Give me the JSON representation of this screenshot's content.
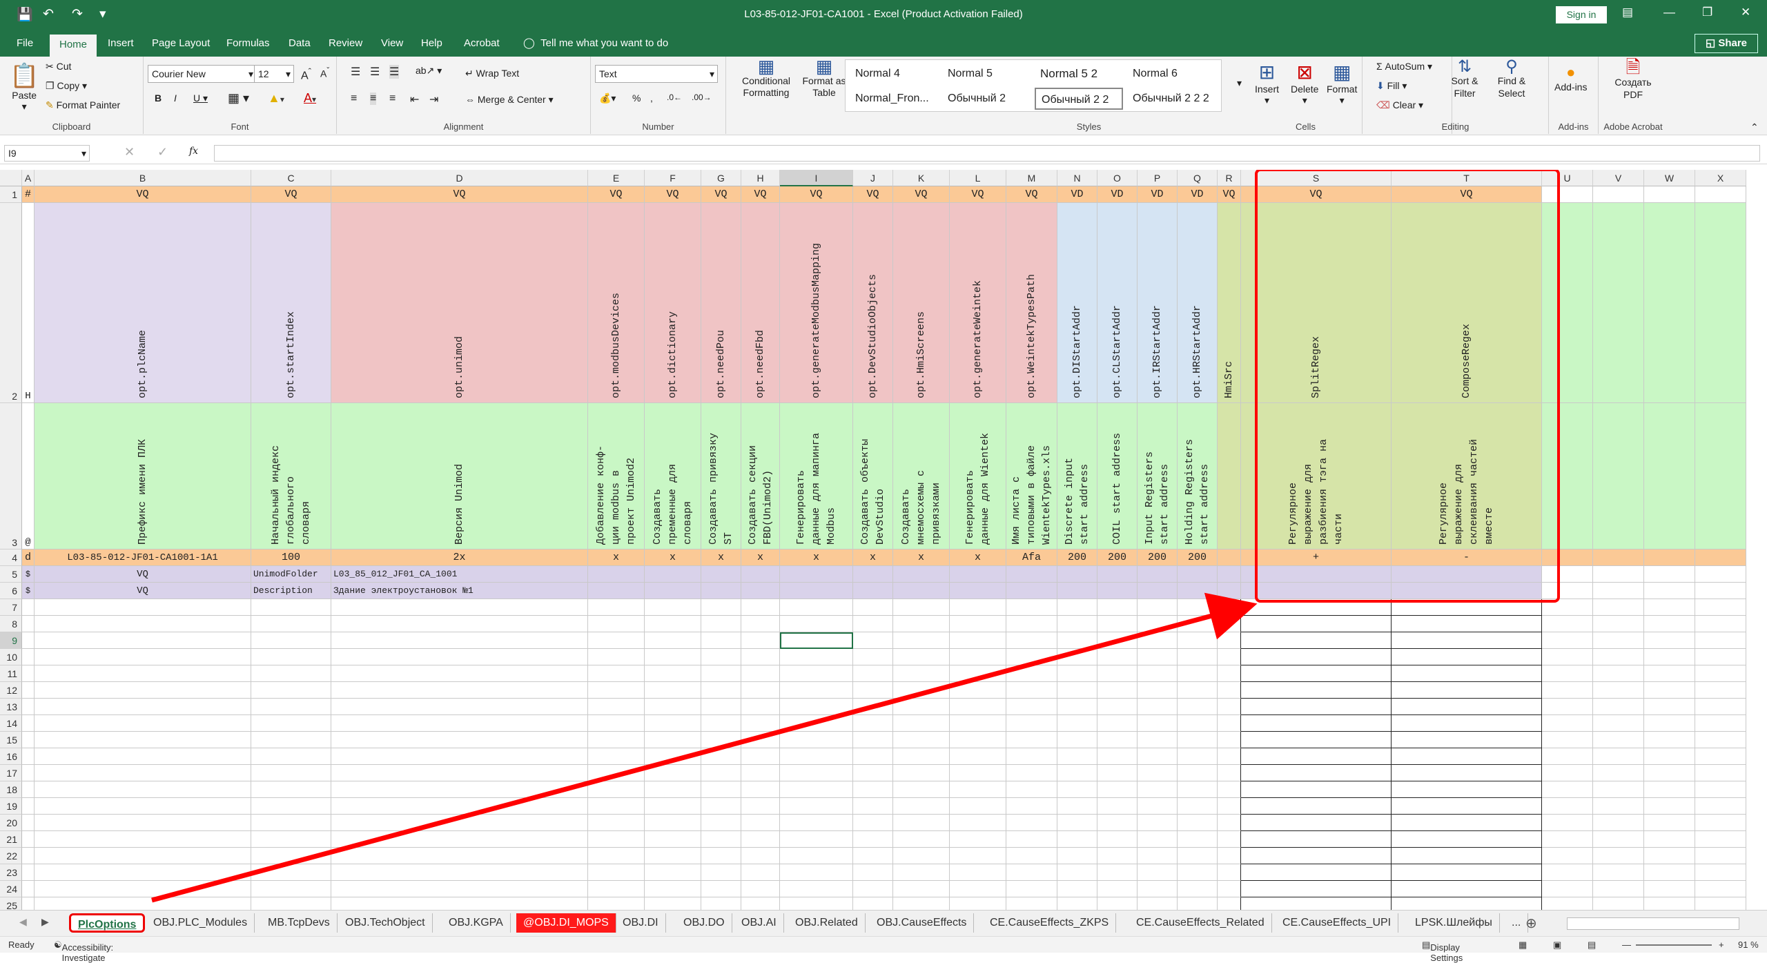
{
  "titlebar": {
    "title": "L03-85-012-JF01-CA1001  -  Excel (Product Activation Failed)",
    "signin": "Sign in"
  },
  "tabs": [
    "File",
    "Home",
    "Insert",
    "Page Layout",
    "Formulas",
    "Data",
    "Review",
    "View",
    "Help",
    "Acrobat"
  ],
  "tellme": "Tell me what you want to do",
  "share": "Share",
  "ribbon": {
    "clipboard": {
      "paste": "Paste",
      "cut": "Cut",
      "copy": "Copy",
      "painter": "Format Painter",
      "label": "Clipboard"
    },
    "font": {
      "name": "Courier New",
      "size": "12",
      "label": "Font"
    },
    "alignment": {
      "wrap": "Wrap Text",
      "merge": "Merge & Center",
      "label": "Alignment"
    },
    "number": {
      "format": "Text",
      "label": "Number"
    },
    "styles": {
      "cond": "Conditional Formatting",
      "fmt_table": "Format as Table",
      "cells": [
        "Normal 4",
        "Normal 5",
        "Normal 5 2",
        "Normal 6",
        "Normal_Fron...",
        "Обычный 2",
        "Обычный 2 2",
        "Обычный 2 2 2"
      ],
      "label": "Styles"
    },
    "cells": {
      "insert": "Insert",
      "delete": "Delete",
      "format": "Format",
      "label": "Cells"
    },
    "editing": {
      "autosum": "AutoSum",
      "fill": "Fill",
      "clear": "Clear",
      "sort": "Sort & Filter",
      "find": "Find & Select",
      "label": "Editing"
    },
    "addins": {
      "btn": "Add-ins",
      "label": "Add-ins"
    },
    "acrobat": {
      "btn": "Создать PDF",
      "label": "Adobe Acrobat"
    }
  },
  "formula": {
    "namebox": "I9",
    "fx": "fx",
    "value": ""
  },
  "grid": {
    "columns": [
      "A",
      "B",
      "C",
      "D",
      "E",
      "F",
      "G",
      "H",
      "I",
      "J",
      "K",
      "L",
      "M",
      "N",
      "O",
      "P",
      "Q",
      "R",
      "S",
      "T",
      "U",
      "V",
      "W",
      "X"
    ],
    "rows": [
      "1",
      "2",
      "3",
      "4",
      "5",
      "6",
      "7",
      "8",
      "9",
      "10",
      "11",
      "12",
      "13",
      "14",
      "15",
      "16",
      "17",
      "18",
      "19",
      "20",
      "21",
      "22",
      "23",
      "24",
      "25"
    ],
    "row1": [
      "#",
      "VQ",
      "VQ",
      "VQ",
      "VQ",
      "VQ",
      "VQ",
      "VQ",
      "VQ",
      "VQ",
      "VQ",
      "VQ",
      "VQ",
      "VD",
      "VD",
      "VD",
      "VD",
      "VQ",
      "VQ",
      "VQ"
    ],
    "row2": [
      "H",
      "opt.plcName",
      "opt.startIndex",
      "opt.unimod",
      "opt.modbusDevices",
      "opt.dictionary",
      "opt.needPou",
      "opt.needFbd",
      "opt.generateModbusMapping",
      "opt.DevStudioObjects",
      "opt.HmiScreens",
      "opt.generateWeintek",
      "opt.WeintekTypesPath",
      "opt.DIStartAddr",
      "opt.CLStartAddr",
      "opt.IRStartAddr",
      "opt.HRStartAddr",
      "HmiSrc",
      "SplitRegex",
      "ComposeRegex"
    ],
    "row3": [
      "@",
      "Префикс имени ПЛК",
      "Начальный индекс\nглобального\nсловаря",
      "Версия Unimod",
      "Добавление конф-\nции modbus в\nпроект Unimod2",
      "Создавать\nпременные для\nсловаря",
      "Создавать привязку\nST",
      "Создавать секции\nFBD(Unimod2)",
      "Генерировать\nданные для мапинга\nModbus",
      "Создавать объекты\nDevStudio",
      "Создавать\nмнемосхемы с\nпривязками",
      "Генерировать\nданные для Wientek",
      "Имя листа с\nтиповыми в файле\nWientekTypes.xls",
      "Discrete input\nstart address",
      "COIL start address",
      "Input Registers\nstart address",
      "Holding Registers\nstart address",
      "",
      "Регулярное\nвыражение для\nразбиения тэга на\nчасти",
      "Регулярное\nвыражение для\nсклеивания частей\nвместе"
    ],
    "row4": [
      "d",
      "L03-85-012-JF01-CA1001-1A1",
      "100",
      "2x",
      "x",
      "x",
      "x",
      "x",
      "x",
      "x",
      "x",
      "x",
      "Afa",
      "200",
      "200",
      "200",
      "200",
      "",
      "+",
      "-"
    ],
    "row5": {
      "a": "$",
      "b": "VQ",
      "c": "UnimodFolder",
      "d": "L03_85_012_JF01_CA_1001"
    },
    "row6": {
      "a": "$",
      "b": "VQ",
      "c": "Description",
      "d": "Здание электроустановок №1"
    }
  },
  "sheets": [
    "PlcOptions",
    "OBJ.PLC_Modules",
    "MB.TcpDevs",
    "OBJ.TechObject",
    "OBJ.KGPA",
    "@OBJ.DI_MOPS",
    "OBJ.DI",
    "OBJ.DO",
    "OBJ.AI",
    "OBJ.Related",
    "OBJ.CauseEffects",
    "CE.CauseEffects_ZKPS",
    "CE.CauseEffects_Related",
    "CE.CauseEffects_UPI",
    "LPSK.Шлейфы",
    "..."
  ],
  "status": {
    "ready": "Ready",
    "access": "Accessibility: Investigate",
    "display": "Display Settings",
    "zoom": "91 %"
  },
  "colors": {
    "excel_green": "#217346",
    "highlight": "#ff0000"
  }
}
